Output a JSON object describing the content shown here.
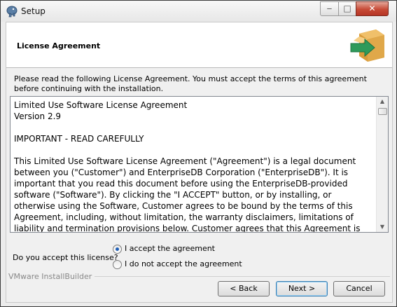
{
  "window": {
    "title": "Setup",
    "controls": {
      "minimize": "‒",
      "maximize": "□",
      "close": "✕"
    }
  },
  "header": {
    "title": "License Agreement",
    "icon": "package-arrow-icon"
  },
  "intro_text": "Please read the following License Agreement. You must accept the terms of this agreement before continuing with the installation.",
  "license": {
    "text": "Limited Use Software License Agreement\nVersion 2.9\n\nIMPORTANT - READ CAREFULLY\n\nThis Limited Use Software License Agreement (\"Agreement\") is a legal document between you (\"Customer\") and EnterpriseDB Corporation (\"EnterpriseDB\"). It is important that you read this document before using the EnterpriseDB-provided software (\"Software\"). By clicking the \"I ACCEPT\" button, or by installing, or otherwise using the Software, Customer agrees to be bound by the terms of this Agreement, including, without limitation, the warranty disclaimers, limitations of liability and termination provisions below. Customer agrees that this Agreement is enforceable like any written"
  },
  "acceptance": {
    "question": "Do you accept this license?",
    "options": [
      {
        "label": "I accept the agreement",
        "selected": true
      },
      {
        "label": "I do not accept the agreement",
        "selected": false
      }
    ]
  },
  "footer": {
    "brand": "VMware InstallBuilder"
  },
  "buttons": {
    "back": "< Back",
    "next": "Next >",
    "cancel": "Cancel"
  },
  "colors": {
    "box_icon": "#e0a84a",
    "arrow_icon": "#2e9a5a",
    "close_button": "#c74a36",
    "radio_selected": "#1f5fb6"
  }
}
